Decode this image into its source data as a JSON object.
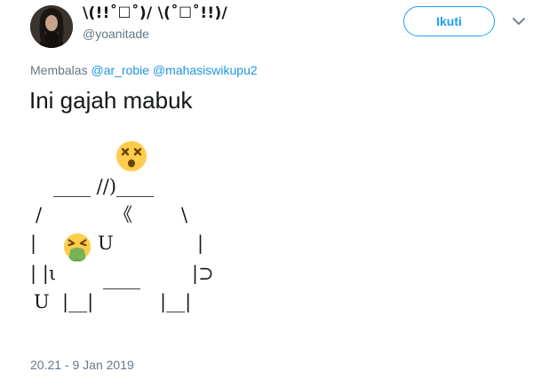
{
  "author": {
    "display_name": "\\(!!˚☐˚)/ \\(˚☐˚!!)/",
    "username": "@yoanitade"
  },
  "follow_button": {
    "label": "Ikuti"
  },
  "reply": {
    "prefix": "Membalas",
    "mentions": [
      "@ar_robie",
      "@mahasiswikupu2"
    ]
  },
  "tweet": {
    "text": "Ini gajah mabuk",
    "art": {
      "row1": "____ //)____",
      "row2_left": "/",
      "row2_mid": "《",
      "row2_right": "\\",
      "row3_left": "|",
      "row3_u": "U",
      "row3_right": "|",
      "row4_left": "| |ι",
      "row4_mid": "____",
      "row4_right": "|⊃",
      "row5_u": "U",
      "row5_legs1": "|__|",
      "row5_legs2": "|__|"
    },
    "timestamp": "20.21 - 9 Jan 2019"
  },
  "icons": {
    "dizzy_face": "dizzy-face-emoji",
    "vomiting_face": "vomiting-face-emoji",
    "caret": "chevron-down-icon"
  },
  "colors": {
    "accent": "#1da1f2",
    "mention": "#1b95e0",
    "secondary_text": "#657786",
    "primary_text": "#14171a"
  }
}
